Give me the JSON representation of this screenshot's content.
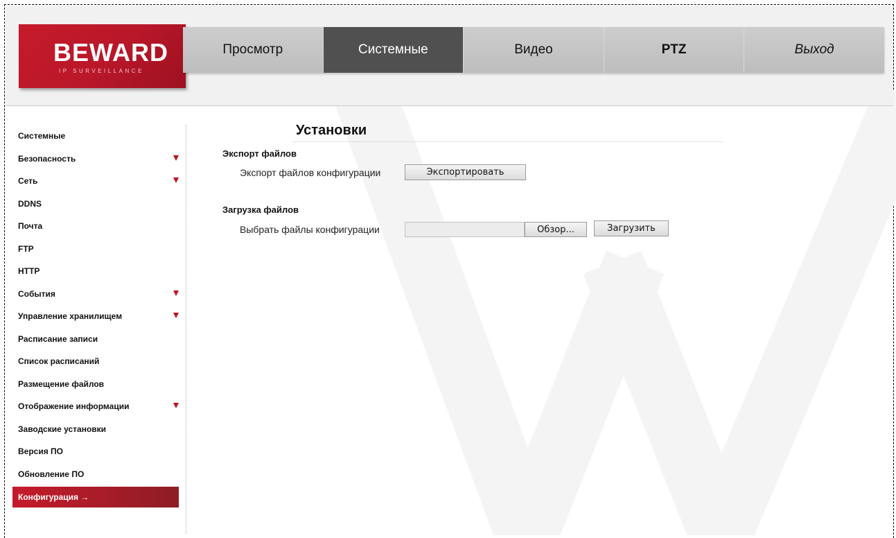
{
  "logo": {
    "brand": "BEWARD",
    "tagline": "IP SURVEILLANCE"
  },
  "nav": {
    "items": [
      {
        "label": "Просмотр"
      },
      {
        "label": "Системные"
      },
      {
        "label": "Видео"
      },
      {
        "label": "PTZ"
      },
      {
        "label": "Выход"
      }
    ]
  },
  "sidebar": {
    "items": [
      {
        "label": "Системные"
      },
      {
        "label": "Безопасность"
      },
      {
        "label": "Сеть"
      },
      {
        "label": "DDNS"
      },
      {
        "label": "Почта"
      },
      {
        "label": "FTP"
      },
      {
        "label": "HTTP"
      },
      {
        "label": "События"
      },
      {
        "label": "Управление хранилищем"
      },
      {
        "label": "Расписание записи"
      },
      {
        "label": "Список расписаний"
      },
      {
        "label": "Размещение файлов"
      },
      {
        "label": "Отображение информации"
      },
      {
        "label": "Заводские установки"
      },
      {
        "label": "Версия ПО"
      },
      {
        "label": "Обновление ПО"
      },
      {
        "label": "Конфигурация →"
      }
    ]
  },
  "main": {
    "title": "Установки",
    "export": {
      "heading": "Экспорт файлов",
      "label": "Экспорт файлов конфигурации",
      "button": "Экспортировать"
    },
    "upload": {
      "heading": "Загрузка файлов",
      "label": "Выбрать файлы конфигурации",
      "file_value": "",
      "browse_button": "Обзор...",
      "upload_button": "Загрузить"
    }
  },
  "colors": {
    "brand_red": "#c51b2a",
    "nav_active": "#505050",
    "arrow_red": "#c4121e"
  }
}
